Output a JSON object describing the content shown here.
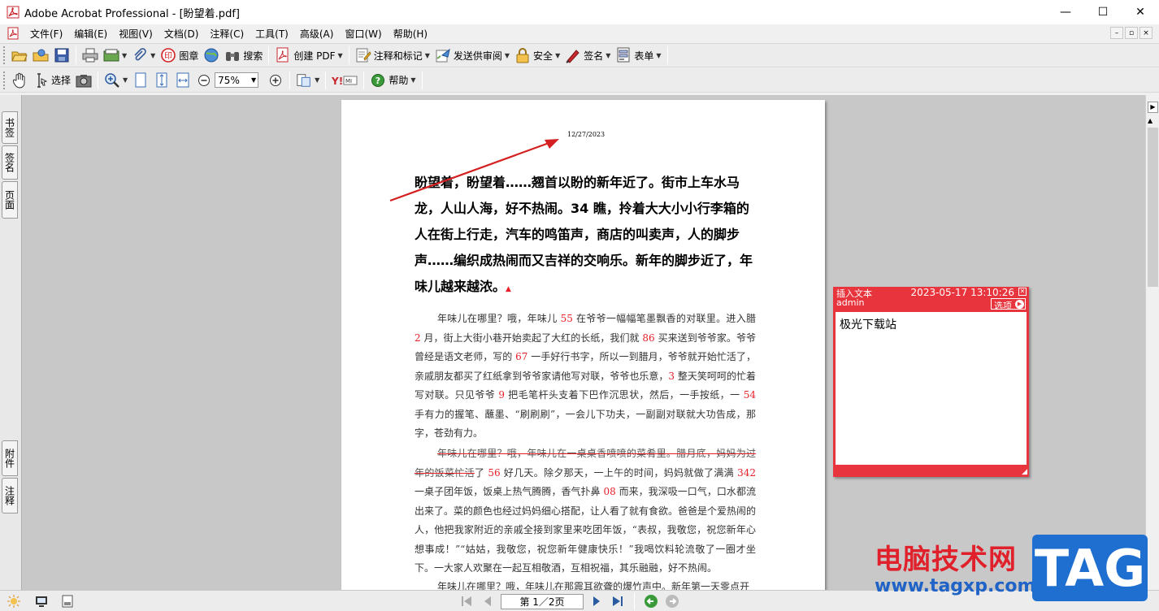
{
  "window": {
    "title": "Adobe Acrobat Professional - [盼望着.pdf]",
    "minimize": "—",
    "maximize": "☐",
    "close": "✕"
  },
  "menu": {
    "items": [
      "文件(F)",
      "编辑(E)",
      "视图(V)",
      "文档(D)",
      "注释(C)",
      "工具(T)",
      "高级(A)",
      "窗口(W)",
      "帮助(H)"
    ]
  },
  "toolbar1": {
    "stamp_label": "图章",
    "search_label": "搜索",
    "create_pdf_label": "创建 PDF",
    "comment_label": "注释和标记",
    "review_label": "发送供审阅",
    "security_label": "安全",
    "sign_label": "签名",
    "form_label": "表单"
  },
  "toolbar2": {
    "select_label": "选择",
    "zoom_value": "75%",
    "help_label": "帮助"
  },
  "side_tabs": {
    "bookmarks": "书签",
    "signatures": "签名",
    "pages": "页面",
    "attachments": "附件",
    "comments": "注释"
  },
  "document": {
    "date": "12/27/2023",
    "heading": "盼望着，盼望着……翘首以盼的新年近了。街市上车水马龙，人山人海，好不热闹。34 瞧，拎着大大小小行李箱的人在街上行走，汽车的鸣笛声，商店的叫卖声，人的脚步声……编织成热闹而又吉祥的交响乐。新年的脚步近了，年味儿越来越浓。",
    "para1": [
      {
        "t": "年味儿在哪里？哦，年味儿 "
      },
      {
        "n": "55"
      },
      {
        "t": " 在爷爷一幅幅笔墨飘香的对联里。进入腊 "
      },
      {
        "n": "2"
      },
      {
        "t": " 月，街上大街小巷开始卖起了大红的长纸，我们就 "
      },
      {
        "n": "86"
      },
      {
        "t": " 买来送到爷爷家。爷爷曾经是语文老师，写的 "
      },
      {
        "n": "67"
      },
      {
        "t": " 一手好行书字，所以一到腊月，爷爷就开始忙活了，亲戚朋友都买了红纸拿到爷爷家请他写对联，爷爷也乐意，"
      },
      {
        "n": "3"
      },
      {
        "t": " 整天笑呵呵的忙着写对联。只见爷爷 "
      },
      {
        "n": "9"
      },
      {
        "t": " 把毛笔杆头支着下巴作沉思状，然后，一手按纸，一 "
      },
      {
        "n": "54"
      },
      {
        "t": " 手有力的握笔、蘸墨、“刷刷刷”，一会儿下功夫，一副副对联就大功告成，那字，苍劲有力。"
      }
    ],
    "para2_struck": "年味儿在哪里？哦，年味儿在一桌桌香喷喷的菜肴里。腊月底，妈妈为过年的饭菜忙活",
    "para2": [
      {
        "t": "了 "
      },
      {
        "n": "56"
      },
      {
        "t": " 好几天。除夕那天，一上午的时间，妈妈就做了满满 "
      },
      {
        "n": "342"
      },
      {
        "t": " 一桌子团年饭，饭桌上热气腾腾，香气扑鼻 "
      },
      {
        "n": "08"
      },
      {
        "t": " 而来，我深吸一口气，口水都流出来了。菜的颜色也经过妈妈细心搭配，让人看了就有食欲。爸爸是个爱热闹的人，他把我家附近的亲戚全接到家里来吃团年饭，“表叔，我敬您，祝您新年心想事成！”“姑姑，我敬您，祝您新年健康快乐！”我喝饮料轮流敬了一圈才坐下。一大家人欢聚在一起互相敬酒，互相祝福，其乐融融，好不热闹。"
      }
    ],
    "para3": "年味儿在哪里？哦，年味儿在那震耳欲聋的爆竹声中。新年第一天零点开"
  },
  "note": {
    "title": "插入文本",
    "timestamp": "2023-05-17 13:10:26",
    "author": "admin",
    "options_label": "选项",
    "content": "极光下载站"
  },
  "status": {
    "page_indicator": "第 1／2页"
  },
  "watermark": {
    "site_name": "电脑技术网",
    "url": "www.tagxp.com",
    "badge": "TAG"
  },
  "colors": {
    "note_red": "#e8353d",
    "number_red": "#e8202a",
    "arrow_red": "#d42020",
    "brand_blue": "#1f6fd1"
  }
}
